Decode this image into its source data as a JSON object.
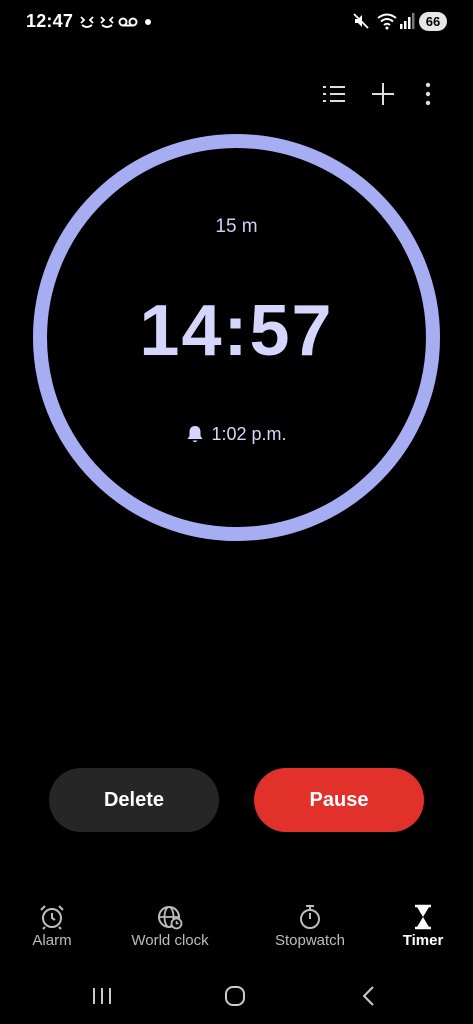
{
  "status_bar": {
    "time": "12:47",
    "notification_icons": [
      "face-icon",
      "face-icon",
      "voicemail-icon"
    ],
    "battery": "66"
  },
  "toolbar": {
    "icons": [
      "list-icon",
      "plus-icon",
      "more-vert-icon"
    ]
  },
  "timer": {
    "total": "15 m",
    "remaining": "14:57",
    "end_time": "1:02 p.m.",
    "progress_fraction": 1.0,
    "ring_color": "#a7adf2"
  },
  "actions": {
    "delete_label": "Delete",
    "pause_label": "Pause",
    "pause_color": "#e1312a"
  },
  "bottom_nav": {
    "items": [
      {
        "label": "Alarm",
        "icon": "alarm-icon",
        "active": false
      },
      {
        "label": "World clock",
        "icon": "globe-icon",
        "active": false
      },
      {
        "label": "Stopwatch",
        "icon": "stopwatch-icon",
        "active": false
      },
      {
        "label": "Timer",
        "icon": "hourglass-icon",
        "active": true
      }
    ]
  },
  "system_nav": {
    "icons": [
      "recent-apps-icon",
      "home-icon",
      "back-icon"
    ]
  }
}
